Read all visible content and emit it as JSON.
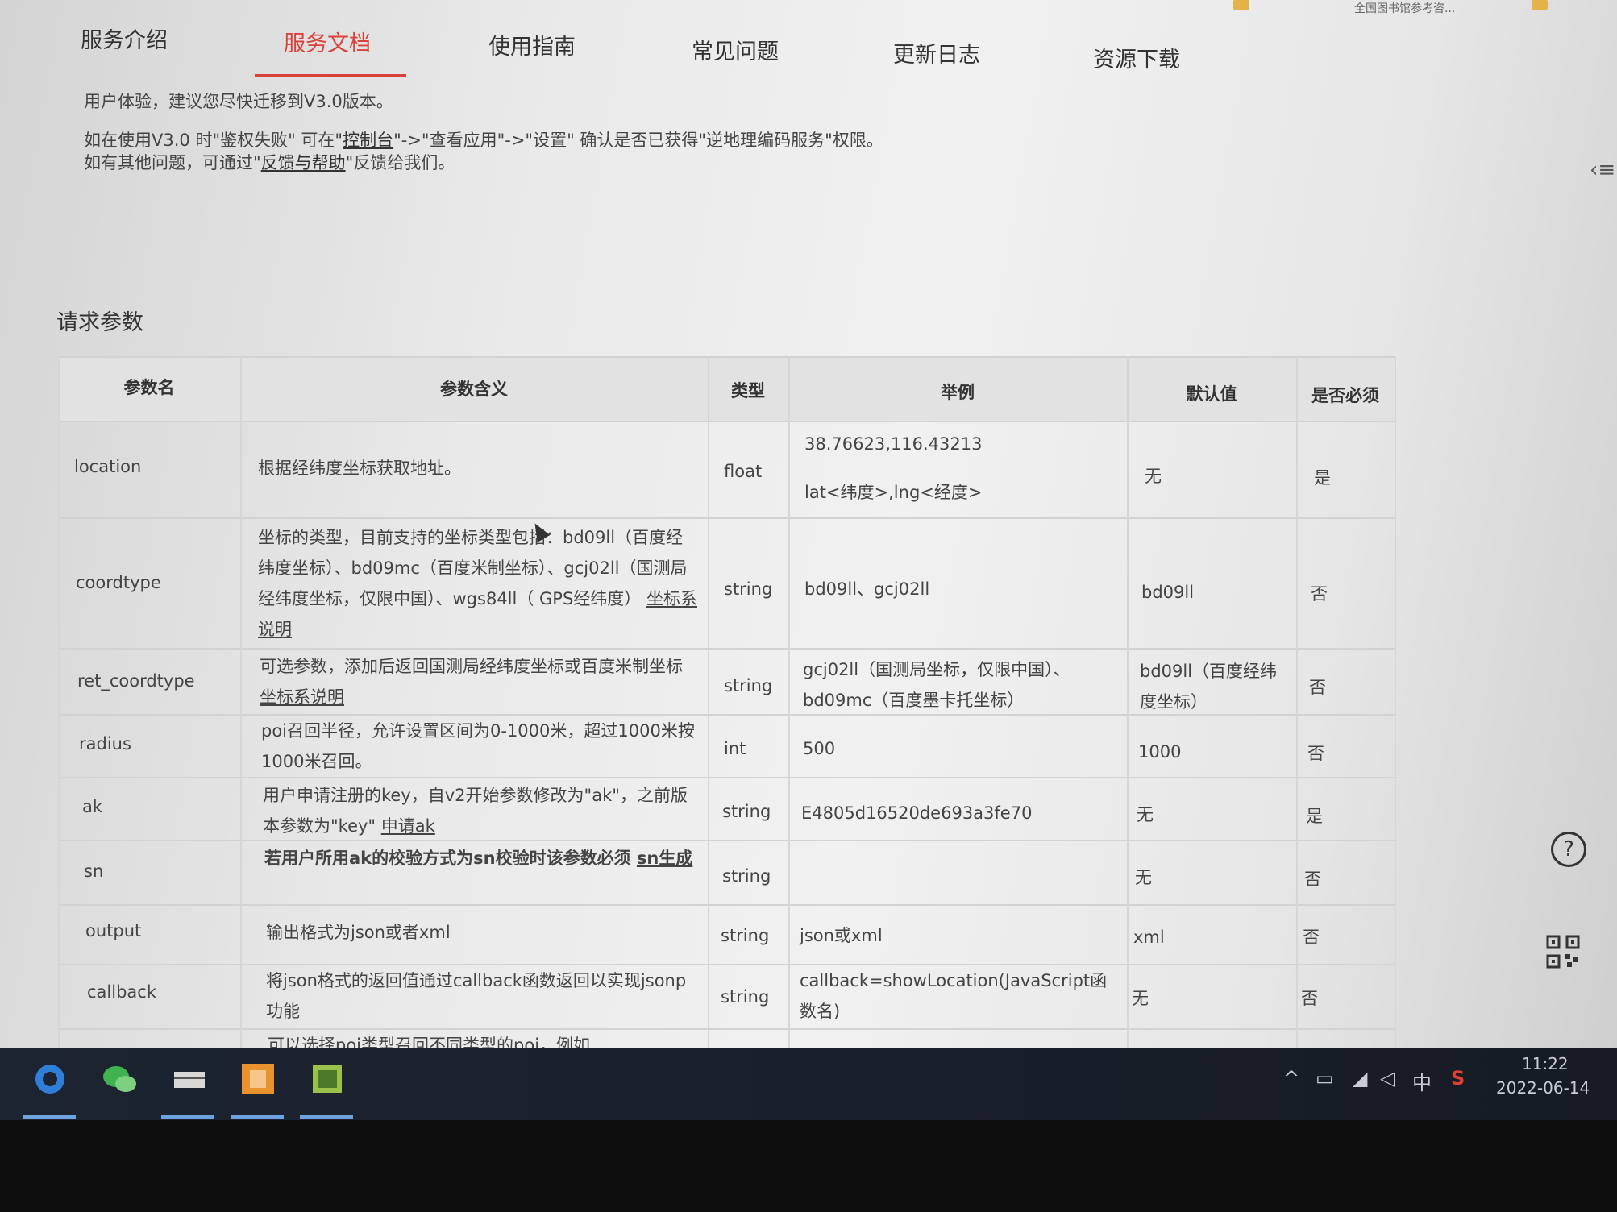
{
  "nav": {
    "items": [
      "服务介绍",
      "服务文档",
      "使用指南",
      "常见问题",
      "更新日志",
      "资源下载"
    ],
    "active": "服务文档"
  },
  "bookmarks": [
    "全国图书馆参考咨..."
  ],
  "notice": {
    "line1": "用户体验，建议您尽快迁移到V3.0版本。",
    "line2_pre": "如在使用V3.0 时\"鉴权失败\" 可在\"",
    "line2_link": "控制台",
    "line2_post": "\"->\"查看应用\"->\"设置\" 确认是否已获得\"逆地理编码服务\"权限。",
    "line3_pre": "如有其他问题，可通过\"",
    "line3_link": "反馈与帮助",
    "line3_post": "\"反馈给我们。"
  },
  "section_title": "请求参数",
  "table": {
    "headers": [
      "参数名",
      "参数含义",
      "类型",
      "举例",
      "默认值",
      "是否必须"
    ],
    "rows": [
      {
        "name": "location",
        "desc": "根据经纬度坐标获取地址。",
        "link": "",
        "type": "float",
        "example": "38.76623,116.43213",
        "example2": "lat<纬度>,lng<经度>",
        "default": "无",
        "required": "是"
      },
      {
        "name": "coordtype",
        "desc": "坐标的类型，目前支持的坐标类型包括：bd09ll（百度经纬度坐标）、bd09mc（百度米制坐标）、gcj02ll（国测局经纬度坐标，仅限中国）、wgs84ll（ GPS经纬度）",
        "link": "坐标系说明",
        "type": "string",
        "example": "bd09ll、gcj02ll",
        "example2": "",
        "default": "bd09ll",
        "required": "否"
      },
      {
        "name": "ret_coordtype",
        "desc": "可选参数，添加后返回国测局经纬度坐标或百度米制坐标",
        "link": "坐标系说明",
        "type": "string",
        "example": "gcj02ll（国测局坐标，仅限中国）、bd09mc（百度墨卡托坐标）",
        "example2": "",
        "default": "bd09ll（百度经纬度坐标）",
        "required": "否"
      },
      {
        "name": "radius",
        "desc": "poi召回半径，允许设置区间为0-1000米，超过1000米按1000米召回。",
        "link": "",
        "type": "int",
        "example": "500",
        "example2": "",
        "default": "1000",
        "required": "否"
      },
      {
        "name": "ak",
        "desc": "用户申请注册的key，自v2开始参数修改为\"ak\"，之前版本参数为\"key\"",
        "link": "申请ak",
        "type": "string",
        "example": "E4805d16520de693a3fe70",
        "example2": "",
        "default": "无",
        "required": "是"
      },
      {
        "name": "sn",
        "desc": "若用户所用ak的校验方式为sn校验时该参数必须",
        "link": "sn生成",
        "type": "string",
        "example": "",
        "example2": "",
        "default": "无",
        "required": "否"
      },
      {
        "name": "output",
        "desc": "输出格式为json或者xml",
        "link": "",
        "type": "string",
        "example": "json或xml",
        "example2": "",
        "default": "xml",
        "required": "否"
      },
      {
        "name": "callback",
        "desc": "将json格式的返回值通过callback函数返回以实现jsonp功能",
        "link": "",
        "type": "string",
        "example": "callback=showLocation(JavaScript函数名)",
        "example2": "",
        "default": "无",
        "required": "否"
      }
    ],
    "partial_row": "可以选择poi类型召回不同类型的poi，例如"
  },
  "help_icon": "?",
  "tray": {
    "ime": "中",
    "time": "11:22",
    "date": "2022-06-14"
  },
  "colors": {
    "accent": "#d9423a",
    "taskbar": "#1d2431"
  }
}
